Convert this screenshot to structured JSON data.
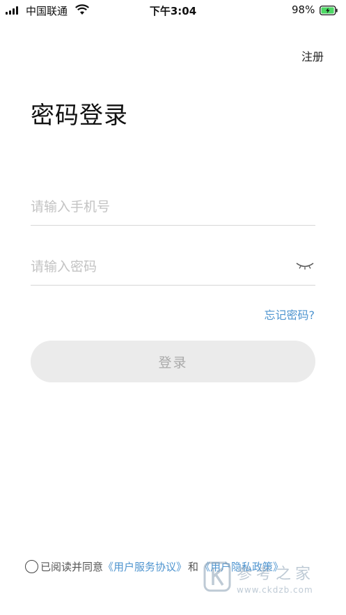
{
  "status_bar": {
    "carrier": "中国联通",
    "time": "下午3:04",
    "battery_percent": "98%",
    "battery_level": 0.98,
    "signal_bars": 4,
    "icons": [
      "signal-icon",
      "wifi-icon",
      "battery-charging-icon"
    ]
  },
  "header": {
    "register_label": "注册"
  },
  "page": {
    "title": "密码登录"
  },
  "form": {
    "phone_placeholder": "请输入手机号",
    "phone_value": "",
    "password_placeholder": "请输入密码",
    "password_value": "",
    "password_toggle_icon": "eye-closed-icon",
    "forgot_label": "忘记密码?",
    "login_label": "登录"
  },
  "agreement": {
    "prefix": "已阅读并同意",
    "terms_link": "《用户服务协议》",
    "conjunction": "和",
    "privacy_link": "《用户隐私政策》",
    "checked": false
  },
  "watermark": {
    "text": "参考之家",
    "url": "www.ckdzb.com"
  },
  "colors": {
    "accent": "#4e94cf",
    "button_bg": "#ebebeb",
    "button_text": "#a9a9a9",
    "divider": "#d6d6d6",
    "battery_green": "#4cd964"
  }
}
